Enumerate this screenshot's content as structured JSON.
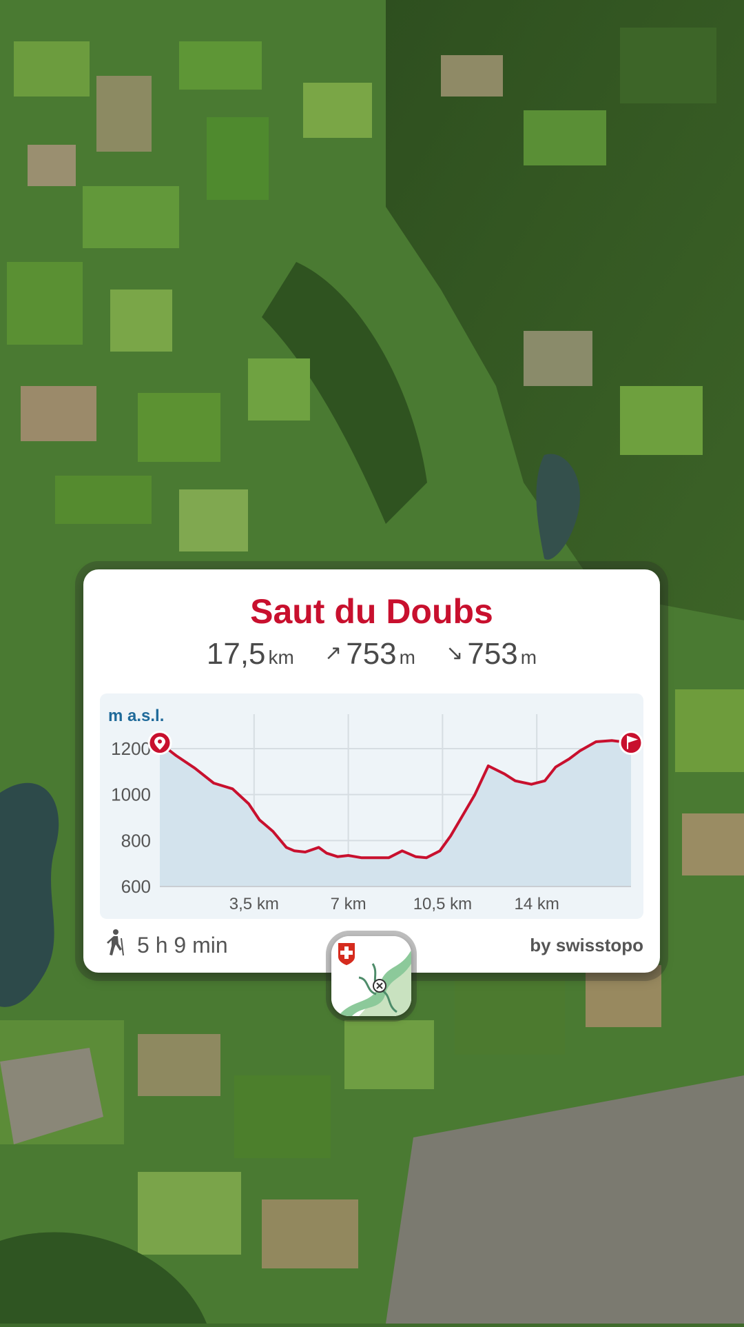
{
  "route": {
    "title": "Saut du Doubs",
    "distance_value": "17,5",
    "distance_unit": "km",
    "ascent_value": "753",
    "ascent_unit": "m",
    "descent_value": "753",
    "descent_unit": "m",
    "ascent_arrow": "↗",
    "descent_arrow": "↘",
    "duration": "5 h 9 min",
    "credit": "by swisstopo"
  },
  "colors": {
    "accent": "#c8102e",
    "profile_fill": "#d3e3ed",
    "chart_bg": "#eef4f8",
    "axis_label_blue": "#1f6a9a"
  },
  "icons": {
    "start": "location-pin-icon",
    "end": "flag-icon",
    "hiker": "hiker-icon",
    "app": "swisstopo-app-icon"
  },
  "chart_data": {
    "type": "area",
    "ylabel": "m a.s.l.",
    "xlabel": "",
    "x_unit": "km",
    "ylim": [
      600,
      1250
    ],
    "xlim": [
      0,
      17.5
    ],
    "y_ticks": [
      1200,
      1000,
      800,
      600
    ],
    "y_tick_labels": [
      "1200",
      "1000",
      "800",
      "600"
    ],
    "x_ticks": [
      3.5,
      7,
      10.5,
      14
    ],
    "x_tick_labels": [
      "3,5 km",
      "7 km",
      "10,5 km",
      "14 km"
    ],
    "grid": true,
    "series": [
      {
        "x": [
          0,
          0.6,
          1.3,
          2.0,
          2.7,
          3.3,
          3.7,
          4.2,
          4.7,
          5.0,
          5.4,
          5.9,
          6.2,
          6.6,
          7.0,
          7.5,
          8.0,
          8.5,
          9.0,
          9.5,
          9.9,
          10.4,
          10.8,
          11.2,
          11.7,
          12.2,
          12.8,
          13.2,
          13.8,
          14.3,
          14.7,
          15.2,
          15.6,
          16.2,
          16.8,
          17.5
        ],
        "y": [
          1225,
          1170,
          1115,
          1050,
          1025,
          960,
          890,
          840,
          770,
          755,
          750,
          770,
          745,
          730,
          735,
          725,
          725,
          725,
          755,
          730,
          725,
          755,
          820,
          900,
          1000,
          1125,
          1090,
          1060,
          1045,
          1060,
          1120,
          1155,
          1190,
          1230,
          1235,
          1225
        ]
      }
    ]
  }
}
